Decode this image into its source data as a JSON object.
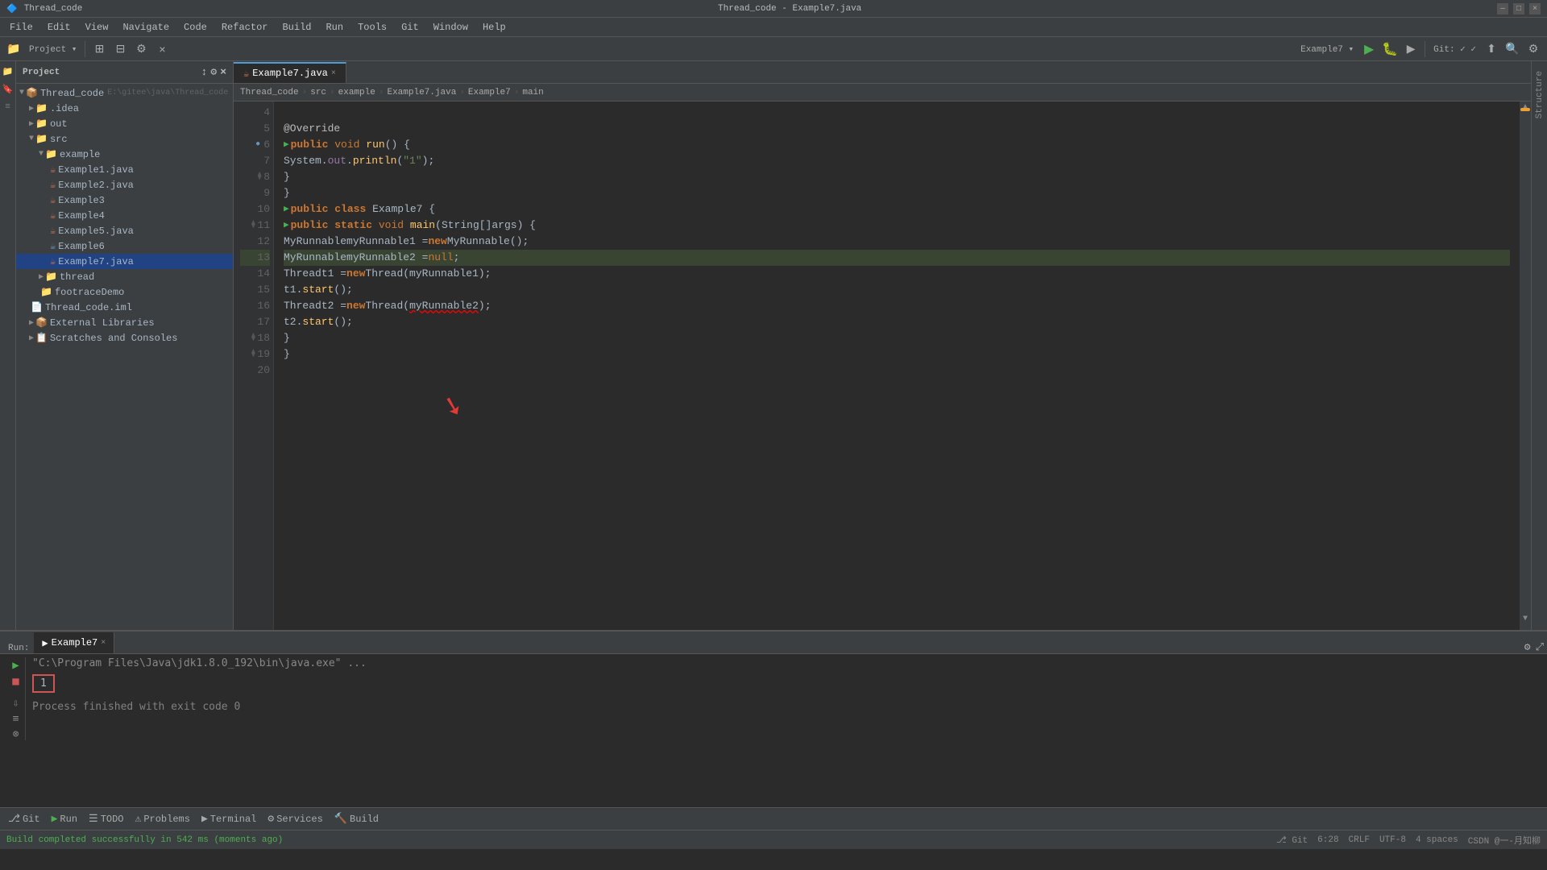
{
  "titlebar": {
    "project": "Thread_code",
    "title": "Thread_code - Example7.java",
    "minimize": "–",
    "maximize": "□",
    "close": "×"
  },
  "menu": {
    "items": [
      "File",
      "Edit",
      "View",
      "Navigate",
      "Code",
      "Refactor",
      "Build",
      "Run",
      "Tools",
      "Git",
      "Window",
      "Help"
    ]
  },
  "breadcrumb": {
    "parts": [
      "Thread_code",
      "src",
      "example",
      "Example7.java",
      "Example7",
      "main"
    ]
  },
  "tabs": {
    "active": "Example7.java",
    "items": [
      "Example7.java"
    ]
  },
  "project": {
    "title": "Project",
    "root": "Thread_code",
    "root_path": "E:\\gitee\\java\\Thread_code",
    "tree": [
      {
        "label": ".idea",
        "level": 1,
        "type": "folder",
        "expanded": false
      },
      {
        "label": "out",
        "level": 1,
        "type": "folder",
        "expanded": false
      },
      {
        "label": "src",
        "level": 1,
        "type": "folder",
        "expanded": true
      },
      {
        "label": "example",
        "level": 2,
        "type": "folder",
        "expanded": true
      },
      {
        "label": "Example1.java",
        "level": 3,
        "type": "java"
      },
      {
        "label": "Example2.java",
        "level": 3,
        "type": "java"
      },
      {
        "label": "Example3",
        "level": 3,
        "type": "java"
      },
      {
        "label": "Example4",
        "level": 3,
        "type": "java"
      },
      {
        "label": "Example5.java",
        "level": 3,
        "type": "java"
      },
      {
        "label": "Example6",
        "level": 3,
        "type": "java",
        "selected": false
      },
      {
        "label": "Example7.java",
        "level": 3,
        "type": "java",
        "selected": true
      },
      {
        "label": "thread",
        "level": 2,
        "type": "folder",
        "expanded": false
      },
      {
        "label": "footraceDemo",
        "level": 2,
        "type": "folder"
      },
      {
        "label": "Thread_code.iml",
        "level": 1,
        "type": "xml"
      },
      {
        "label": "External Libraries",
        "level": 1,
        "type": "folder",
        "expanded": false
      },
      {
        "label": "Scratches and Consoles",
        "level": 1,
        "type": "folder",
        "expanded": false
      }
    ]
  },
  "code": {
    "lines": [
      {
        "num": 4,
        "content": "",
        "tokens": []
      },
      {
        "num": 5,
        "content": "    @Override",
        "type": "annotation"
      },
      {
        "num": 6,
        "content": "    public void run() {",
        "type": "method_decl",
        "has_run_icon": true,
        "has_gutter": true
      },
      {
        "num": 7,
        "content": "        System.out.println(\"1\");",
        "type": "code"
      },
      {
        "num": 8,
        "content": "    }",
        "type": "code",
        "has_gutter": true
      },
      {
        "num": 9,
        "content": "}",
        "type": "code"
      },
      {
        "num": 10,
        "content": "public class Example7 {",
        "type": "class_decl",
        "has_run_icon": true
      },
      {
        "num": 11,
        "content": "    public static void main(String[] args) {",
        "type": "method_decl",
        "has_run_icon": true,
        "has_gutter": true
      },
      {
        "num": 12,
        "content": "        MyRunnable myRunnable1 = new MyRunnable();",
        "type": "code"
      },
      {
        "num": 13,
        "content": "        MyRunnable myRunnable2 = null;",
        "type": "code"
      },
      {
        "num": 14,
        "content": "        Thread t1 = new Thread(myRunnable1);",
        "type": "code"
      },
      {
        "num": 15,
        "content": "        t1.start();",
        "type": "code"
      },
      {
        "num": 16,
        "content": "        Thread t2 = new Thread(myRunnable2);",
        "type": "code",
        "has_underline": true
      },
      {
        "num": 17,
        "content": "        t2.start();",
        "type": "code"
      },
      {
        "num": 18,
        "content": "    }",
        "type": "code",
        "has_gutter": true
      },
      {
        "num": 19,
        "content": "}",
        "type": "code",
        "has_gutter": true
      },
      {
        "num": 20,
        "content": "",
        "type": "empty"
      }
    ]
  },
  "console": {
    "run_label": "Run:",
    "tab_label": "Example7",
    "command": "\"C:\\Program Files\\Java\\jdk1.8.0_192\\bin\\java.exe\" ...",
    "output_1": "1",
    "output_2": "Process finished with exit code 0"
  },
  "bottom_toolbar": {
    "items": [
      {
        "icon": "⬡",
        "label": "Git"
      },
      {
        "icon": "▶",
        "label": "Run"
      },
      {
        "icon": "☰",
        "label": "TODO"
      },
      {
        "icon": "⚠",
        "label": "Problems"
      },
      {
        "icon": "▶",
        "label": "Terminal"
      },
      {
        "icon": "⚙",
        "label": "Services"
      },
      {
        "icon": "🔨",
        "label": "Build"
      }
    ]
  },
  "statusbar": {
    "build_msg": "Build completed successfully in 542 ms (moments ago)",
    "git_icon": "⎇",
    "git_branch": "Git",
    "position": "6:28",
    "crlf": "CRLF",
    "encoding": "UTF-8",
    "indent": "4 spaces",
    "user": "CSDN @一-月知柳"
  }
}
